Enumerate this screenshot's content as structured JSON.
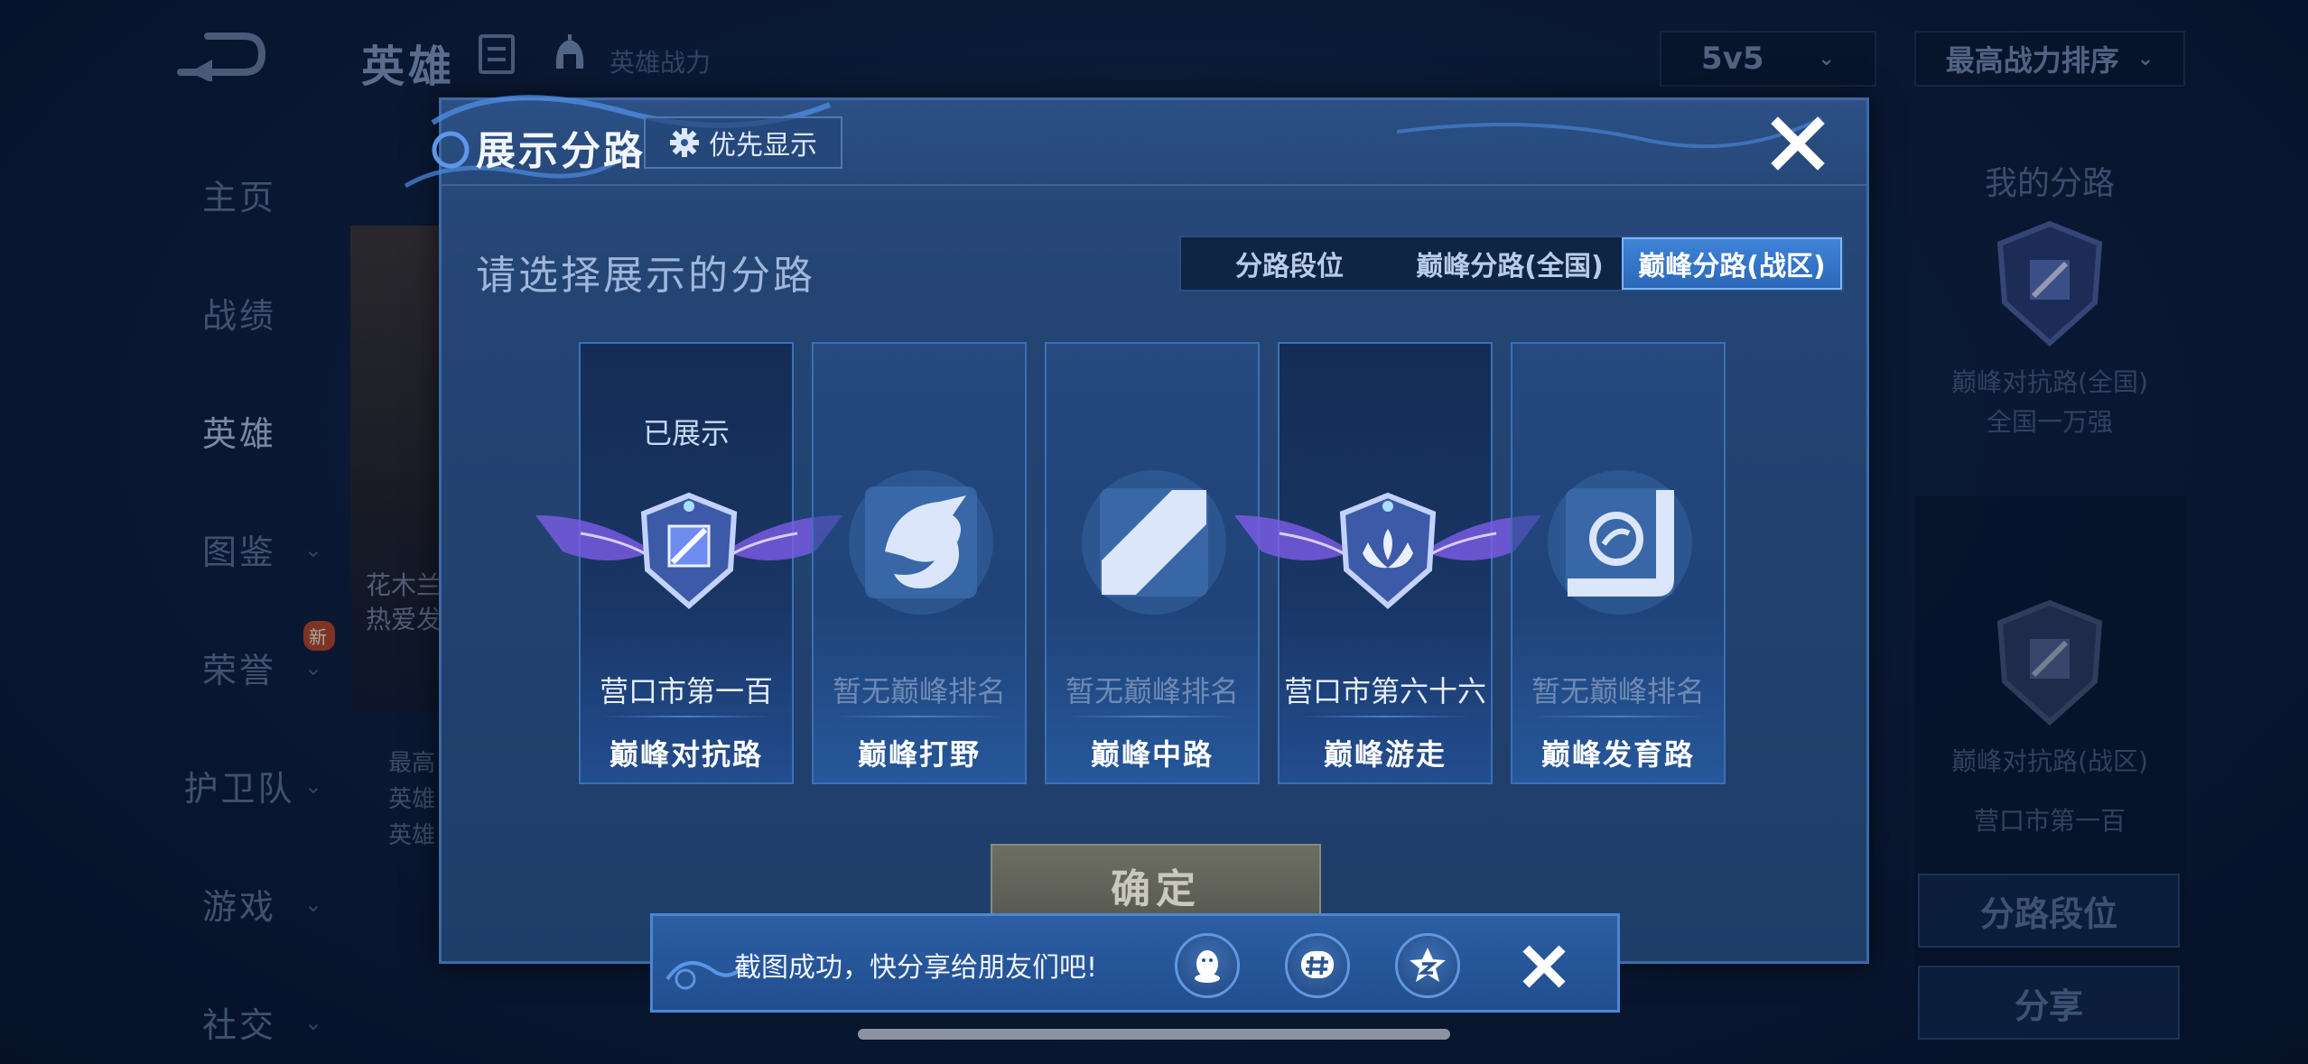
{
  "background": {
    "title": "英雄",
    "subtitle": "英雄战力",
    "mode_select": "5v5",
    "sort_select": "最高战力排序",
    "nav": [
      {
        "label": "主页",
        "chevron": false
      },
      {
        "label": "战绩",
        "chevron": false
      },
      {
        "label": "英雄",
        "chevron": false,
        "active": true
      },
      {
        "label": "图鉴",
        "chevron": true
      },
      {
        "label": "荣誉",
        "chevron": true,
        "badge": "新"
      },
      {
        "label": "护卫队",
        "chevron": true
      },
      {
        "label": "游戏",
        "chevron": true
      },
      {
        "label": "社交",
        "chevron": true
      }
    ],
    "card_text": [
      "花木兰",
      "热爱发"
    ],
    "card_lower_text": [
      "最高",
      "英雄",
      "英雄"
    ],
    "right_panel": {
      "title": "我的分路",
      "badge1_label": "巅峰对抗路(全国)",
      "badge1_rank": "全国一万强",
      "badge2_label": "巅峰对抗路(战区)",
      "badge2_rank": "营口市第一百",
      "button1": "分路段位",
      "button2": "分享"
    }
  },
  "modal": {
    "title": "展示分路",
    "priority_button": "优先显示",
    "prompt": "请选择展示的分路",
    "tabs": [
      {
        "label": "分路段位",
        "active": false
      },
      {
        "label": "巅峰分路(全国)",
        "active": false
      },
      {
        "label": "巅峰分路(战区)",
        "active": true
      }
    ],
    "lanes": [
      {
        "status": "已展示",
        "rank": "营口市第一百",
        "name": "巅峰对抗路",
        "icon": "top-lane-winged-icon",
        "ranked": true
      },
      {
        "status": "",
        "rank": "暂无巅峰排名",
        "name": "巅峰打野",
        "icon": "jungle-dragon-icon",
        "ranked": false
      },
      {
        "status": "",
        "rank": "暂无巅峰排名",
        "name": "巅峰中路",
        "icon": "mid-lane-icon",
        "ranked": false
      },
      {
        "status": "",
        "rank": "营口市第六十六",
        "name": "巅峰游走",
        "icon": "support-winged-icon",
        "ranked": true
      },
      {
        "status": "",
        "rank": "暂无巅峰排名",
        "name": "巅峰发育路",
        "icon": "bot-lane-icon",
        "ranked": false
      }
    ],
    "confirm": "确定"
  },
  "toast": {
    "message": "截图成功，快分享给朋友们吧!",
    "share_icons": [
      "qq-icon",
      "wechat-moments-icon",
      "qzone-icon"
    ]
  },
  "colors": {
    "accent": "#3f84d8",
    "modal_bg": "#244574",
    "lane_border": "#3a70b6",
    "confirm_bg": "#6d6e63"
  }
}
